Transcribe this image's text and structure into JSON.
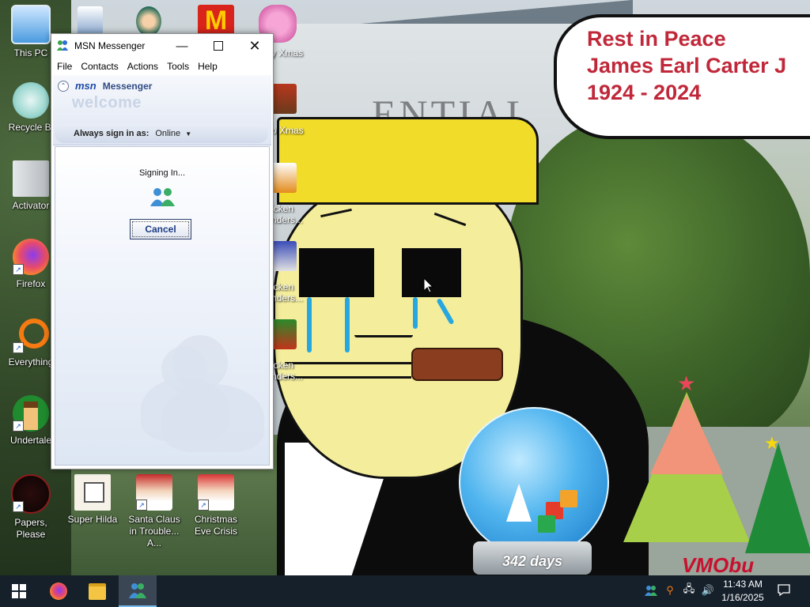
{
  "desktop": {
    "icons": [
      {
        "name": "this-pc",
        "label": "This PC"
      },
      {
        "name": "recycle-bin",
        "label": "Recycle Bi"
      },
      {
        "name": "activator",
        "label": "Activator"
      },
      {
        "name": "firefox",
        "label": "Firefox"
      },
      {
        "name": "everything",
        "label": "Everything"
      },
      {
        "name": "undertale",
        "label": "Undertale"
      },
      {
        "name": "papers-please",
        "label": "Papers, Please"
      },
      {
        "name": "super-hilda",
        "label": "Super Hilda"
      },
      {
        "name": "santa-claus",
        "label": "Santa Claus in Trouble... A..."
      },
      {
        "name": "christmas-eve-crisis",
        "label": "Christmas Eve Crisis"
      }
    ],
    "partial_labels": {
      "xmas_top": "y Xmas",
      "xmas_mid": "o Xmas",
      "chicken_1": "icken\nnders...",
      "chicken_2": "icken\nnders...",
      "chicken_3": "icken\nnders..."
    }
  },
  "wallpaper": {
    "bubble_text": "Rest in Peace\nJames Earl Carter J\n1924 - 2024",
    "building_text": "ENTIAL",
    "globe_label": "342 days",
    "watermark": "VMObu"
  },
  "window": {
    "title": "MSN Messenger",
    "menu": [
      "File",
      "Contacts",
      "Actions",
      "Tools",
      "Help"
    ],
    "brand_msn": "msn",
    "brand_messenger": "Messenger",
    "welcome": "welcome",
    "sign_in_label": "Always sign in as:",
    "sign_in_status": "Online",
    "signing_in": "Signing In...",
    "cancel": "Cancel"
  },
  "taskbar": {
    "time": "11:43 AM",
    "date": "1/16/2025"
  },
  "colors": {
    "taskbar": "#15202b",
    "bubble_text": "#c0283a",
    "messenger_brand": "#1c4aa8"
  }
}
